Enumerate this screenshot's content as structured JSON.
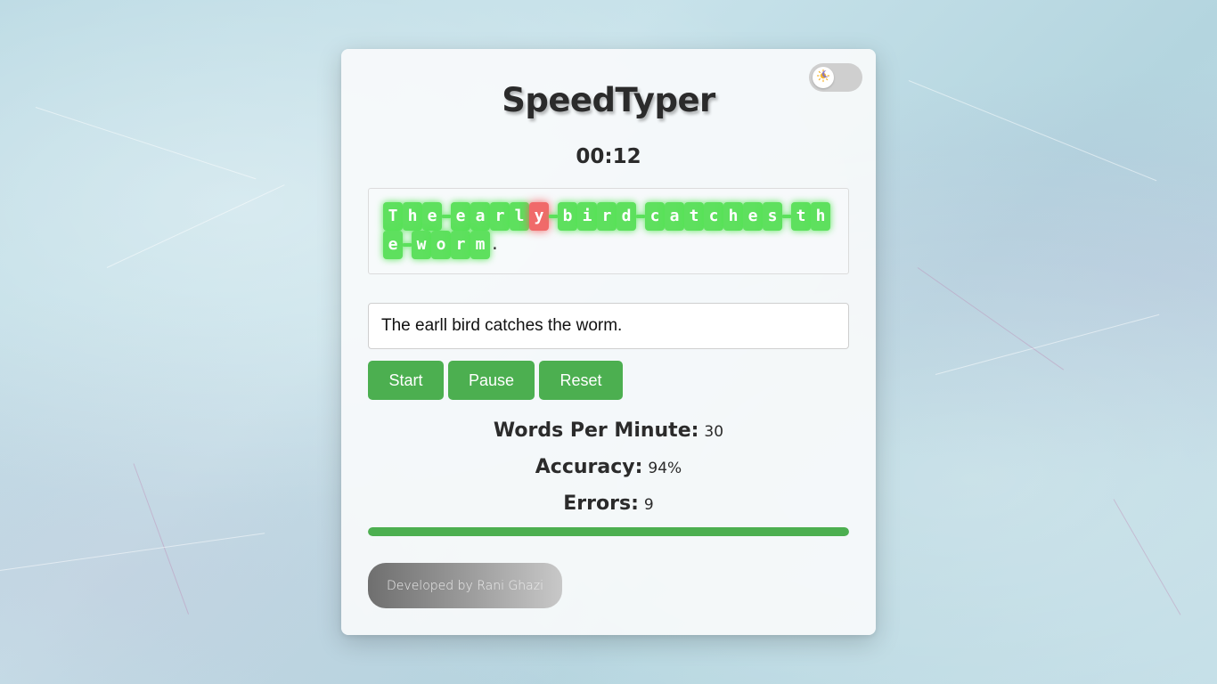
{
  "app": {
    "title": "SpeedTyper",
    "timer": "00:12"
  },
  "theme_toggle": {
    "icon": "sun-moon-icon",
    "state": "light"
  },
  "prompt": {
    "text": "The early bird catches the worm.",
    "characters": [
      {
        "char": "T",
        "status": "correct"
      },
      {
        "char": "h",
        "status": "correct"
      },
      {
        "char": "e",
        "status": "correct"
      },
      {
        "char": " ",
        "status": "correct"
      },
      {
        "char": "e",
        "status": "correct"
      },
      {
        "char": "a",
        "status": "correct"
      },
      {
        "char": "r",
        "status": "correct"
      },
      {
        "char": "l",
        "status": "correct"
      },
      {
        "char": "y",
        "status": "incorrect"
      },
      {
        "char": " ",
        "status": "correct"
      },
      {
        "char": "b",
        "status": "correct"
      },
      {
        "char": "i",
        "status": "correct"
      },
      {
        "char": "r",
        "status": "correct"
      },
      {
        "char": "d",
        "status": "correct"
      },
      {
        "char": " ",
        "status": "correct"
      },
      {
        "char": "c",
        "status": "correct"
      },
      {
        "char": "a",
        "status": "correct"
      },
      {
        "char": "t",
        "status": "correct"
      },
      {
        "char": "c",
        "status": "correct"
      },
      {
        "char": "h",
        "status": "correct"
      },
      {
        "char": "e",
        "status": "correct"
      },
      {
        "char": "s",
        "status": "correct"
      },
      {
        "char": " ",
        "status": "correct"
      },
      {
        "char": "t",
        "status": "correct"
      },
      {
        "char": "h",
        "status": "correct"
      },
      {
        "char": "e",
        "status": "correct"
      },
      {
        "char": " ",
        "status": "correct"
      },
      {
        "char": "w",
        "status": "correct"
      },
      {
        "char": "o",
        "status": "correct"
      },
      {
        "char": "r",
        "status": "correct"
      },
      {
        "char": "m",
        "status": "correct"
      },
      {
        "char": ".",
        "status": "pending"
      }
    ]
  },
  "input": {
    "value": "The earll bird catches the worm.",
    "placeholder": ""
  },
  "controls": {
    "start_label": "Start",
    "pause_label": "Pause",
    "reset_label": "Reset"
  },
  "stats": {
    "wpm_label": "Words Per Minute:",
    "wpm_value": "30",
    "accuracy_label": "Accuracy:",
    "accuracy_value": "94%",
    "errors_label": "Errors:",
    "errors_value": "9"
  },
  "progress": {
    "fraction": 1.0
  },
  "footer": {
    "credit": "Developed by Rani Ghazi"
  },
  "colors": {
    "accent": "#4caf50",
    "correct": "#5ee05e",
    "incorrect": "#f06a6a"
  }
}
